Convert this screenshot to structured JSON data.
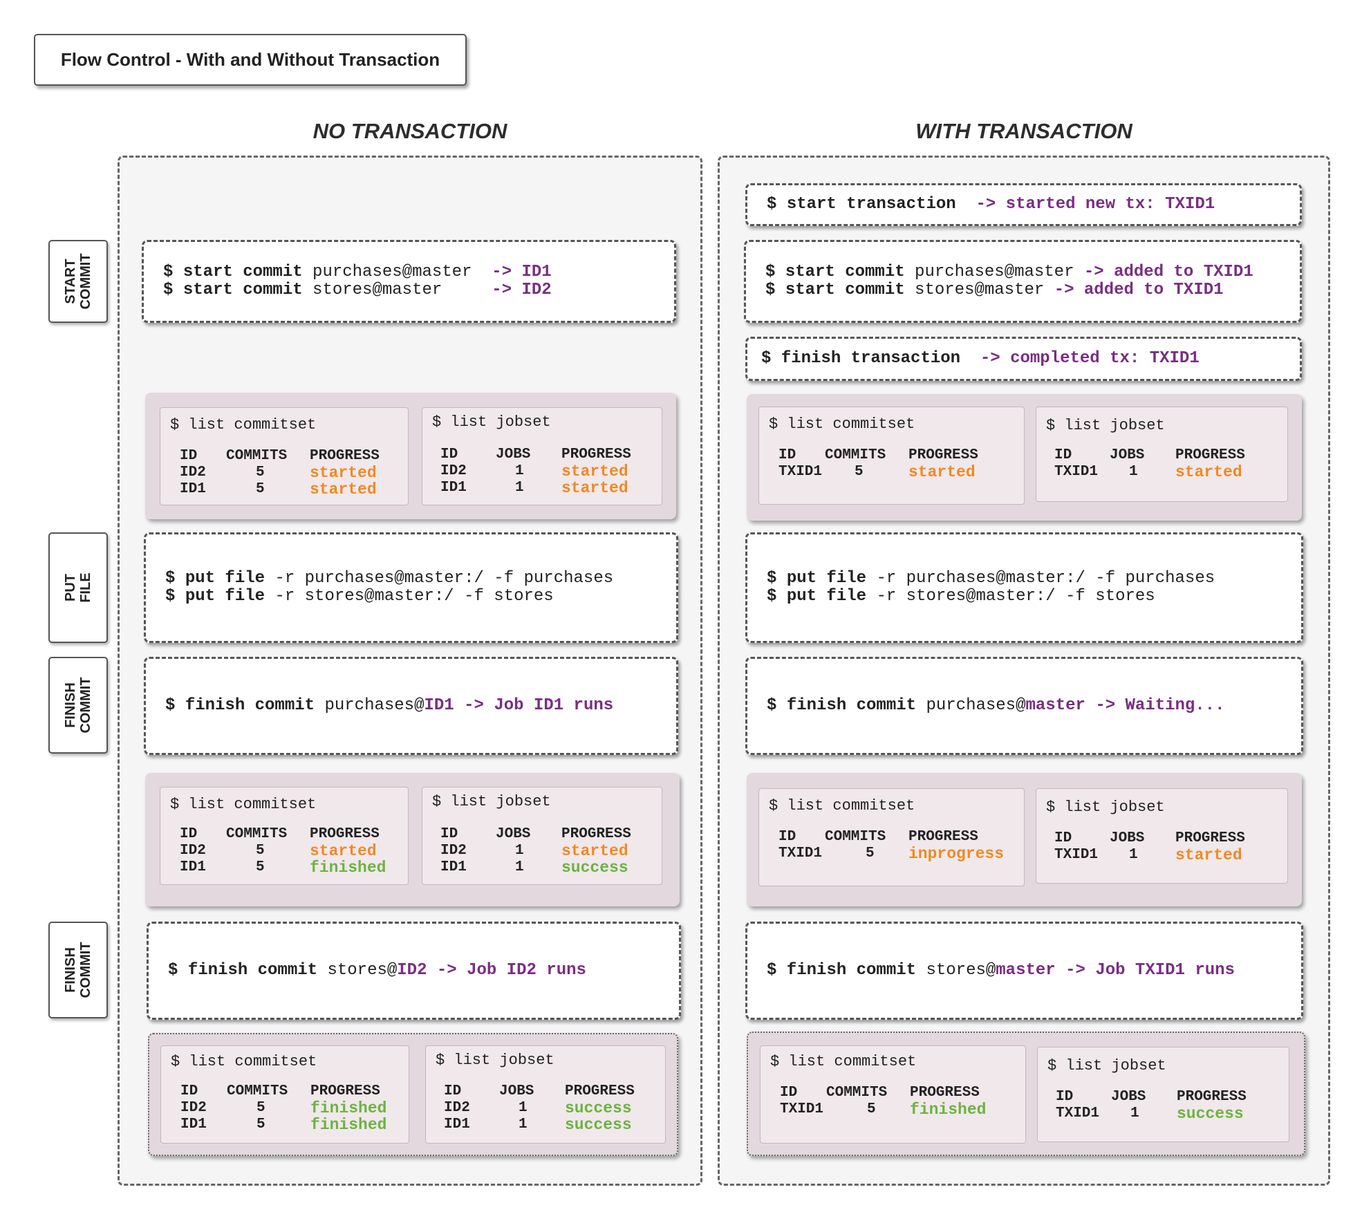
{
  "title": "Flow Control - With and Without Transaction",
  "columns": {
    "left": "NO TRANSACTION",
    "right": "WITH TRANSACTION"
  },
  "side_labels": {
    "start_commit": [
      "START",
      "COMMIT"
    ],
    "put_file": [
      "PUT",
      "FILE"
    ],
    "finish_commit_1": [
      "FINISH",
      "COMMIT"
    ],
    "finish_commit_2": [
      "FINISH",
      "COMMIT"
    ]
  },
  "colors": {
    "purple": "#7a2d83",
    "orange": "#ef8a22",
    "green": "#6db33f"
  },
  "left": {
    "start_commit": [
      {
        "dollar": "$",
        "kw": "start commit",
        "arg": "purchases@master",
        "arrow": "-> ID1"
      },
      {
        "dollar": "$",
        "kw": "start commit",
        "arg": "stores@master",
        "arrow": "-> ID2"
      }
    ],
    "put_file": [
      {
        "dollar": "$",
        "kw": "put file",
        "arg": "-r purchases@master:/ -f purchases"
      },
      {
        "dollar": "$",
        "kw": "put file",
        "arg": "-r stores@master:/ -f stores"
      }
    ],
    "finish1": {
      "dollar": "$",
      "kw": "finish commit",
      "arg": "purchases@",
      "ref": "ID1",
      "arrow": "-> Job ID1 runs"
    },
    "finish2": {
      "dollar": "$",
      "kw": "finish commit",
      "arg": "stores@",
      "ref": "ID2",
      "arrow": "-> Job ID2 runs"
    },
    "results": [
      {
        "commitset": {
          "cmd": "$ list commitset",
          "headers": [
            "ID",
            "COMMITS",
            "PROGRESS"
          ],
          "rows": [
            [
              "ID2",
              "5",
              "started"
            ],
            [
              "ID1",
              "5",
              "started"
            ]
          ]
        },
        "jobset": {
          "cmd": "$ list jobset",
          "headers": [
            "ID",
            "JOBS",
            "PROGRESS"
          ],
          "rows": [
            [
              "ID2",
              "1",
              "started"
            ],
            [
              "ID1",
              "1",
              "started"
            ]
          ]
        }
      },
      {
        "commitset": {
          "cmd": "$ list commitset",
          "headers": [
            "ID",
            "COMMITS",
            "PROGRESS"
          ],
          "rows": [
            [
              "ID2",
              "5",
              "started"
            ],
            [
              "ID1",
              "5",
              "finished"
            ]
          ]
        },
        "jobset": {
          "cmd": "$ list jobset",
          "headers": [
            "ID",
            "JOBS",
            "PROGRESS"
          ],
          "rows": [
            [
              "ID2",
              "1",
              "started"
            ],
            [
              "ID1",
              "1",
              "success"
            ]
          ]
        }
      },
      {
        "commitset": {
          "cmd": "$ list commitset",
          "headers": [
            "ID",
            "COMMITS",
            "PROGRESS"
          ],
          "rows": [
            [
              "ID2",
              "5",
              "finished"
            ],
            [
              "ID1",
              "5",
              "finished"
            ]
          ]
        },
        "jobset": {
          "cmd": "$ list jobset",
          "headers": [
            "ID",
            "JOBS",
            "PROGRESS"
          ],
          "rows": [
            [
              "ID2",
              "1",
              "success"
            ],
            [
              "ID1",
              "1",
              "success"
            ]
          ]
        }
      }
    ]
  },
  "right": {
    "start_tx": {
      "dollar": "$",
      "kw": "start transaction",
      "arrow": "-> started new tx: TXID1"
    },
    "start_commit": [
      {
        "dollar": "$",
        "kw": "start commit",
        "arg": "purchases@master",
        "arrow": "-> added to TXID1"
      },
      {
        "dollar": "$",
        "kw": "start commit",
        "arg": "stores@master",
        "arrow": "-> added to TXID1"
      }
    ],
    "finish_tx": {
      "dollar": "$",
      "kw": "finish transaction",
      "arrow": "-> completed tx: TXID1"
    },
    "put_file": [
      {
        "dollar": "$",
        "kw": "put file",
        "arg": "-r purchases@master:/ -f purchases"
      },
      {
        "dollar": "$",
        "kw": "put file",
        "arg": "-r stores@master:/ -f stores"
      }
    ],
    "finish1": {
      "dollar": "$",
      "kw": "finish commit",
      "arg": "purchases@",
      "ref": "master",
      "arrow": "-> Waiting..."
    },
    "finish2": {
      "dollar": "$",
      "kw": "finish commit",
      "arg": "stores@",
      "ref": "master",
      "arrow": "-> Job TXID1 runs"
    },
    "results": [
      {
        "commitset": {
          "cmd": "$ list commitset",
          "headers": [
            "ID",
            "COMMITS",
            "PROGRESS"
          ],
          "rows": [
            [
              "TXID1",
              "5",
              "started"
            ]
          ]
        },
        "jobset": {
          "cmd": "$ list jobset",
          "headers": [
            "ID",
            "JOBS",
            "PROGRESS"
          ],
          "rows": [
            [
              "TXID1",
              "1",
              "started"
            ]
          ]
        }
      },
      {
        "commitset": {
          "cmd": "$ list commitset",
          "headers": [
            "ID",
            "COMMITS",
            "PROGRESS"
          ],
          "rows": [
            [
              "TXID1",
              "5",
              "inprogress"
            ]
          ]
        },
        "jobset": {
          "cmd": "$ list jobset",
          "headers": [
            "ID",
            "JOBS",
            "PROGRESS"
          ],
          "rows": [
            [
              "TXID1",
              "1",
              "started"
            ]
          ]
        }
      },
      {
        "commitset": {
          "cmd": "$ list commitset",
          "headers": [
            "ID",
            "COMMITS",
            "PROGRESS"
          ],
          "rows": [
            [
              "TXID1",
              "5",
              "finished"
            ]
          ]
        },
        "jobset": {
          "cmd": "$ list jobset",
          "headers": [
            "ID",
            "JOBS",
            "PROGRESS"
          ],
          "rows": [
            [
              "TXID1",
              "1",
              "success"
            ]
          ]
        }
      }
    ]
  }
}
